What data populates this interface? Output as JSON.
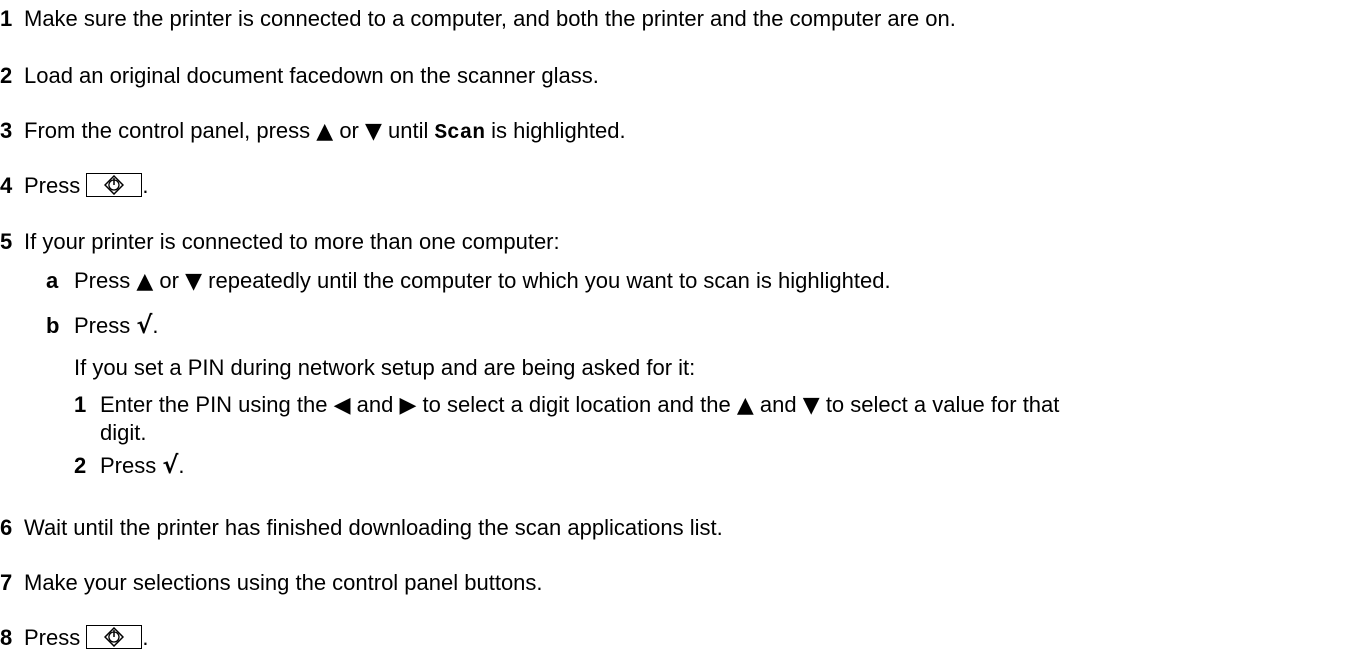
{
  "steps": [
    {
      "num": "1",
      "text": "Make sure the printer is connected to a computer, and both the printer and the computer are on."
    },
    {
      "num": "2",
      "text": "Load an original document facedown on the scanner glass."
    },
    {
      "num": "3",
      "pre": "From the control panel, press",
      "or": "or",
      "until": "until",
      "code": "Scan",
      "post": "is highlighted."
    },
    {
      "num": "4",
      "pre": "Press",
      "post": "."
    },
    {
      "num": "5",
      "text": "If your printer is connected to more than one computer:"
    },
    {
      "num": "6",
      "text": "Wait until the printer has finished downloading the scan applications list."
    },
    {
      "num": "7",
      "text": "Make your selections using the control panel buttons."
    },
    {
      "num": "8",
      "pre": "Press",
      "post": "."
    }
  ],
  "substeps": {
    "a": {
      "letter": "a",
      "pre": "Press",
      "or": "or",
      "post": "repeatedly until the computer to which you want to scan is highlighted."
    },
    "b": {
      "letter": "b",
      "pre": "Press",
      "post": "."
    }
  },
  "pin_intro": "If you set a PIN during network setup and are being asked for it:",
  "pin_steps": {
    "one": {
      "num": "1",
      "pre": "Enter the PIN using the",
      "and1": "and",
      "mid": "to select a digit location and the",
      "and2": "and",
      "post": "to select a value for that",
      "cont": "digit."
    },
    "two": {
      "num": "2",
      "pre": "Press",
      "post": "."
    }
  },
  "icons": {
    "up": "up-arrow-icon",
    "down": "down-arrow-icon",
    "left": "left-arrow-icon",
    "right": "right-arrow-icon",
    "start": "start-button-icon",
    "select": "checkmark-icon"
  }
}
